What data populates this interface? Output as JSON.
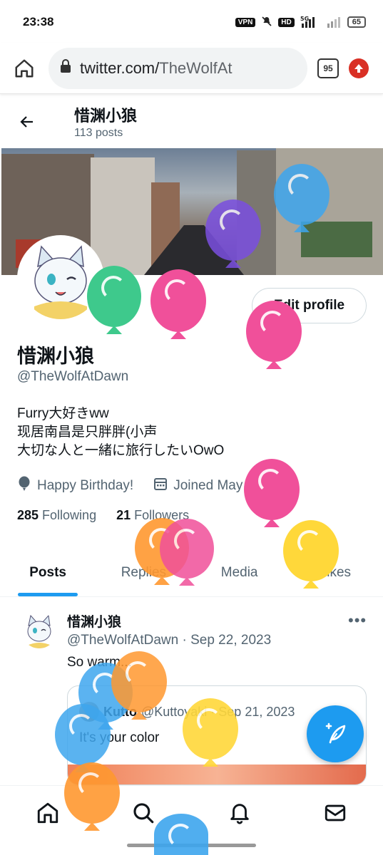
{
  "statusbar": {
    "time": "23:38",
    "vpn": "VPN",
    "hd": "HD",
    "network": "5G",
    "battery": "65"
  },
  "browser": {
    "url_domain": "twitter.com/",
    "url_path": "TheWolfAt",
    "tab_count": "95"
  },
  "header": {
    "name": "惜渊小狼",
    "posts": "113 posts"
  },
  "profile": {
    "edit_label": "Edit profile",
    "name": "惜渊小狼",
    "handle": "@TheWolfAtDawn",
    "bio": [
      "Furry大好きww",
      "现居南昌是只胖胖(小声",
      "大切な人と一緒に旅行したいOwO"
    ],
    "birthday": "Happy Birthday!",
    "joined": "Joined May 2019",
    "following_count": "285",
    "following_label": "Following",
    "followers_count": "21",
    "followers_label": "Followers"
  },
  "tabs": [
    "Posts",
    "Replies",
    "Media",
    "Likes"
  ],
  "post": {
    "author": "惜渊小狼",
    "meta": "@TheWolfAtDawn · Sep 22, 2023",
    "text": "So warm...",
    "more": "•••",
    "quote": {
      "author": "Kutto",
      "meta": "@Kuttoyaki · Sep 21, 2023",
      "text": "It's your color"
    }
  },
  "colors": {
    "accent": "#1d9bf0",
    "text_primary": "#0f1419",
    "text_secondary": "#536471",
    "balloon_green": "#3ec98c",
    "balloon_pink": "#f0509a",
    "balloon_purple": "#7a4fe0",
    "balloon_blue": "#3ea6ee",
    "balloon_orange": "#ff9830",
    "balloon_yellow": "#ffd83a"
  }
}
